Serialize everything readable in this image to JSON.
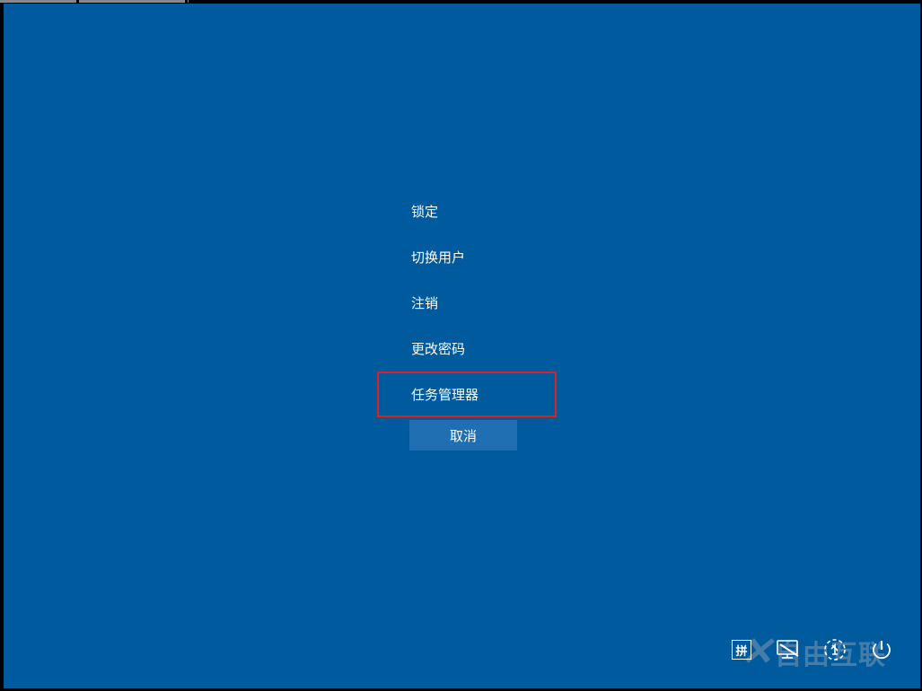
{
  "menu": {
    "items": [
      {
        "label": "锁定",
        "highlighted": false
      },
      {
        "label": "切换用户",
        "highlighted": false
      },
      {
        "label": "注销",
        "highlighted": false
      },
      {
        "label": "更改密码",
        "highlighted": false
      },
      {
        "label": "任务管理器",
        "highlighted": true
      }
    ],
    "cancel_label": "取消"
  },
  "tray": {
    "ime_label": "拼",
    "icons": [
      "network-icon",
      "ease-of-access-icon",
      "power-icon"
    ]
  },
  "watermark": {
    "text": "自由互联"
  },
  "colors": {
    "background": "#005a9e",
    "highlight_border": "#e02020",
    "button_bg": "#1f6fb2"
  }
}
